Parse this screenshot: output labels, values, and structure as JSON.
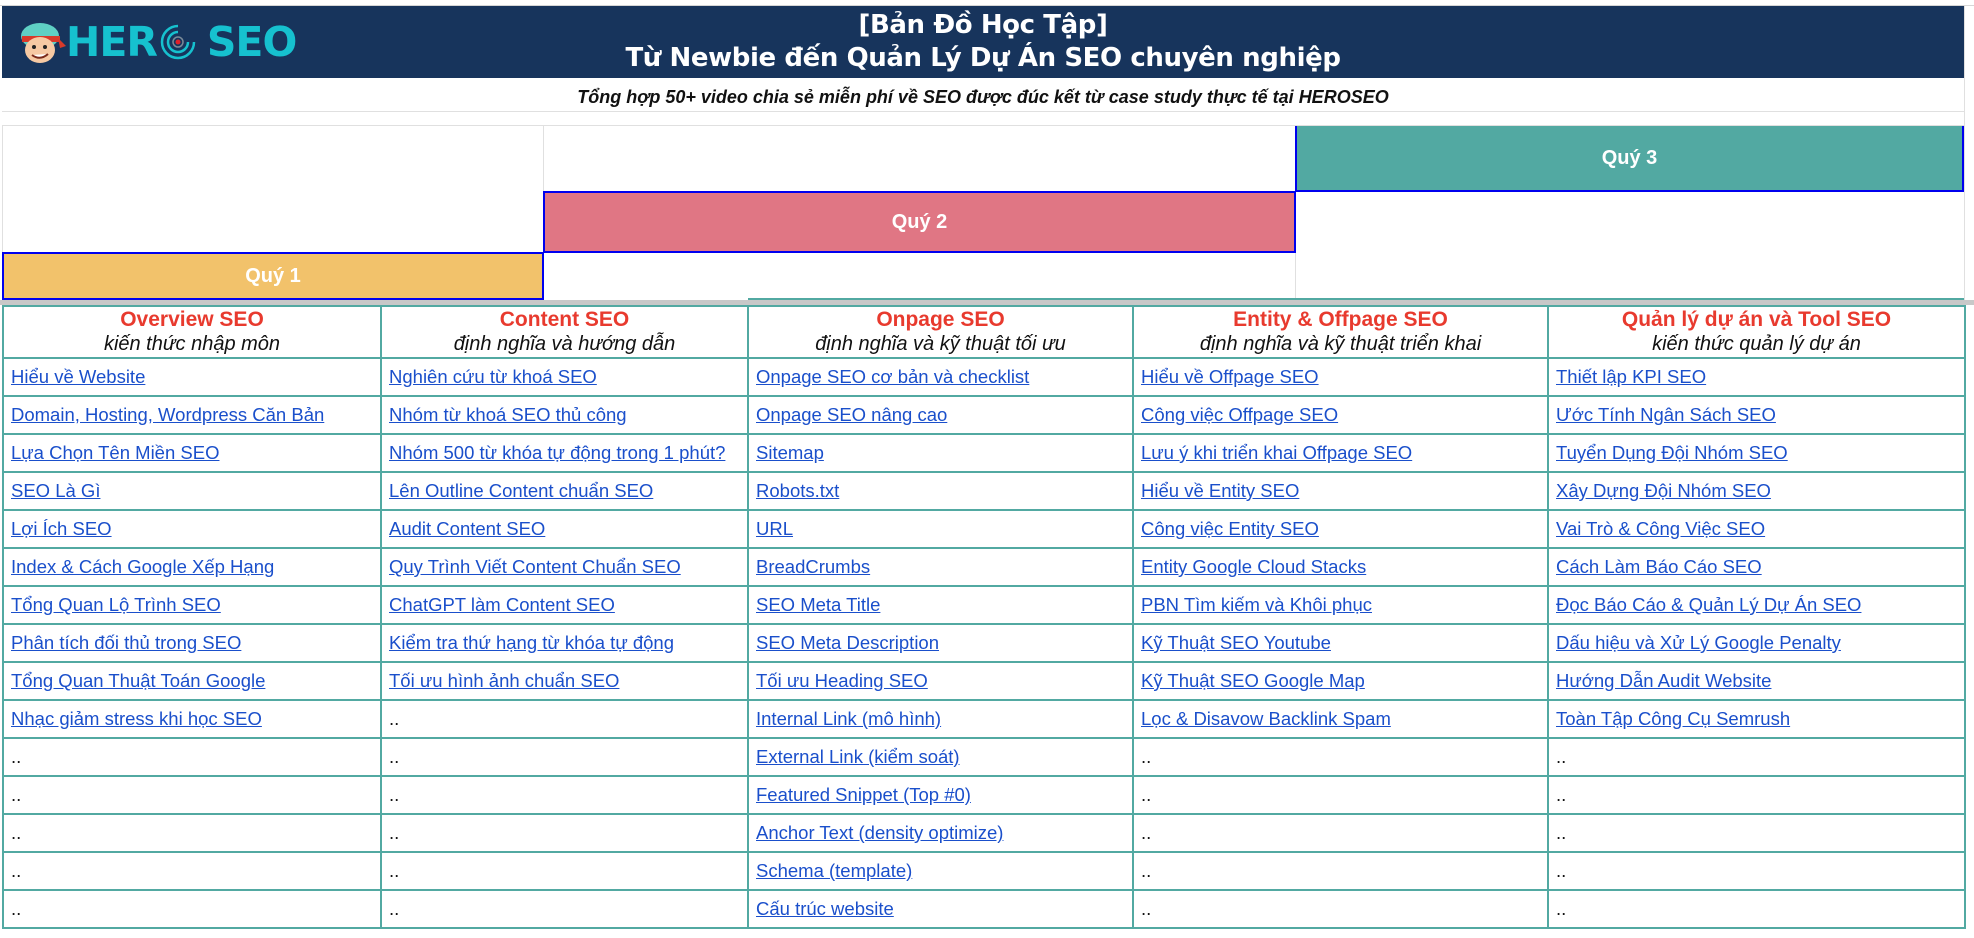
{
  "banner": {
    "logo": {
      "icon": "hero-face-icon",
      "text_left": "HER",
      "ring_icon": "target-ring-icon",
      "text_right": "SEO"
    },
    "title_line1": "[Bản Đồ Học Tập]",
    "title_line2": "Từ Newbie đến Quản Lý Dự Án SEO chuyên nghiệp"
  },
  "subtitle": "Tổng hợp 50+ video chia sẻ miễn phí về SEO được đúc kết từ case study thực tế tại HEROSEO",
  "quarters": [
    {
      "label": "Quý 1",
      "color": "#f2c26b"
    },
    {
      "label": "Quý 2",
      "color": "#e07684"
    },
    {
      "label": "Quý 3",
      "color": "#52a9a2"
    }
  ],
  "colors": {
    "banner": "#17345c",
    "logo": "#16c1cf",
    "category_title": "#e83a2e",
    "link": "#1a4fcb",
    "table_border": "#52a9a2",
    "quarter_border": "#0000ee"
  },
  "columns": [
    {
      "title": "Overview SEO",
      "subtitle": "kiến thức nhập môn",
      "items": [
        "Hiểu về Website",
        "Domain, Hosting, Wordpress Căn Bản",
        "Lựa Chọn Tên Miền SEO",
        "SEO Là Gì",
        "Lợi Ích SEO",
        "Index & Cách Google Xếp Hạng",
        "Tổng Quan Lộ Trình SEO",
        "Phân tích đối thủ trong SEO",
        "Tổng Quan Thuật Toán Google",
        "Nhạc giảm stress khi học SEO",
        "..",
        "..",
        "..",
        "..",
        ".."
      ]
    },
    {
      "title": "Content SEO",
      "subtitle": "định nghĩa và hướng dẫn",
      "items": [
        "Nghiên cứu từ khoá SEO",
        "Nhóm từ khoá SEO thủ công",
        "Nhóm 500 từ khóa tự động trong 1 phút?",
        "Lên Outline Content chuẩn SEO",
        "Audit Content SEO",
        "Quy Trình Viết Content Chuẩn SEO",
        "ChatGPT làm Content SEO",
        "Kiểm tra thứ hạng từ khóa tự động",
        "Tối ưu hình ảnh chuẩn SEO",
        "..",
        "..",
        "..",
        "..",
        "..",
        ".."
      ]
    },
    {
      "title": "Onpage SEO",
      "subtitle": "định nghĩa và kỹ thuật tối ưu",
      "items": [
        "Onpage SEO cơ bản và checklist",
        "Onpage SEO nâng cao",
        "Sitemap",
        "Robots.txt",
        "URL",
        "BreadCrumbs",
        "SEO Meta Title",
        "SEO Meta Description",
        "Tối ưu Heading SEO",
        "Internal Link (mô hình)",
        "External Link (kiểm soát)",
        "Featured Snippet (Top #0)",
        "Anchor Text (density optimize)",
        "Schema (template)",
        "Cấu trúc website"
      ]
    },
    {
      "title": "Entity & Offpage SEO",
      "subtitle": "định nghĩa và kỹ thuật triển khai",
      "items": [
        "Hiểu về Offpage SEO",
        "Công việc Offpage SEO",
        "Lưu ý khi triển khai Offpage SEO",
        "Hiểu về Entity SEO",
        "Công việc Entity SEO",
        "Entity Google Cloud Stacks",
        "PBN Tìm kiếm và Khôi phục",
        "Kỹ Thuật SEO Youtube",
        "Kỹ Thuật SEO Google Map",
        "Lọc & Disavow Backlink Spam",
        "..",
        "..",
        "..",
        "..",
        ".."
      ]
    },
    {
      "title": "Quản lý dự án và Tool SEO",
      "subtitle": "kiến thức quản lý dự án",
      "items": [
        "Thiết lập KPI SEO",
        "Ước Tính Ngân Sách SEO",
        "Tuyển Dụng Đội Nhóm SEO",
        "Xây Dựng Đội Nhóm SEO",
        "Vai Trò & Công Việc SEO",
        "Cách Làm Báo Cáo SEO",
        "Đọc Báo Cáo & Quản Lý Dự Án SEO",
        "Dấu hiệu và Xử Lý Google Penalty",
        "Hướng Dẫn Audit Website",
        "Toàn Tập Công Cụ Semrush",
        "..",
        "..",
        "..",
        "..",
        ".."
      ]
    }
  ]
}
